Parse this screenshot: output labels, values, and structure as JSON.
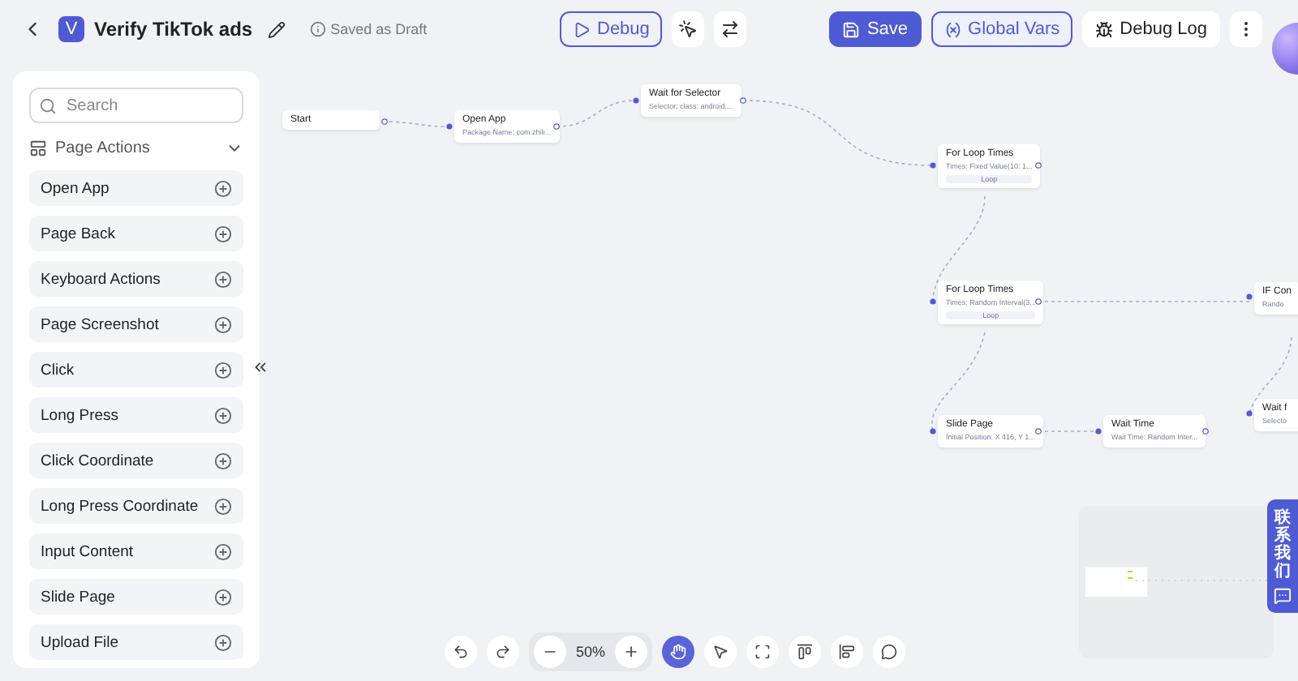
{
  "header": {
    "logo": "V",
    "title": "Verify TikTok ads",
    "status": "Saved as Draft",
    "center_buttons": [
      {
        "kind": "debug",
        "label": "Debug"
      },
      {
        "kind": "auto"
      },
      {
        "kind": "swap"
      }
    ],
    "actions": [
      {
        "kind": "save",
        "label": "Save"
      },
      {
        "kind": "vars",
        "label": "Global Vars"
      },
      {
        "kind": "log",
        "label": "Debug Log"
      }
    ]
  },
  "sidebar": {
    "search": {
      "placeholder": "Search"
    },
    "section": {
      "title": "Page Actions",
      "expanded": true,
      "items": [
        "Open App",
        "Page Back",
        "Keyboard Actions",
        "Page Screenshot",
        "Click",
        "Long Press",
        "Click Coordinate",
        "Long Press Coordinate",
        "Input Content",
        "Slide Page",
        "Upload File"
      ]
    }
  },
  "canvas": {
    "nodes": [
      {
        "title": "Start"
      },
      {
        "title": "Open App",
        "subtitle": "Package Name: com.zhili..."
      },
      {
        "title": "Wait for Selector",
        "subtitle": "Selector: class: android...."
      },
      {
        "title": "For Loop Times",
        "subtitle": "Times: Fixed Value(10: 1...",
        "tag": "Loop"
      },
      {
        "title": "For Loop Times",
        "subtitle": "Times: Random Interval(3...",
        "tag": "Loop"
      },
      {
        "title": "IF Con",
        "subtitle": "Rando"
      },
      {
        "title": "Wait f",
        "subtitle": "Selecto"
      },
      {
        "title": "Slide Page",
        "subtitle": "Initial Position: X 416, Y 1..."
      },
      {
        "title": "Wait Time",
        "subtitle": "Wait Time: Random Inter..."
      }
    ]
  },
  "toolbar": {
    "zoom": "50%",
    "tools": [
      {
        "kind": "hand",
        "selected": true
      },
      {
        "kind": "pointer",
        "selected": false
      },
      {
        "kind": "fit",
        "selected": false
      },
      {
        "kind": "align-top",
        "selected": false
      },
      {
        "kind": "align-left",
        "selected": false
      },
      {
        "kind": "comment",
        "selected": false
      }
    ]
  },
  "contact": {
    "label": "联系我们"
  }
}
